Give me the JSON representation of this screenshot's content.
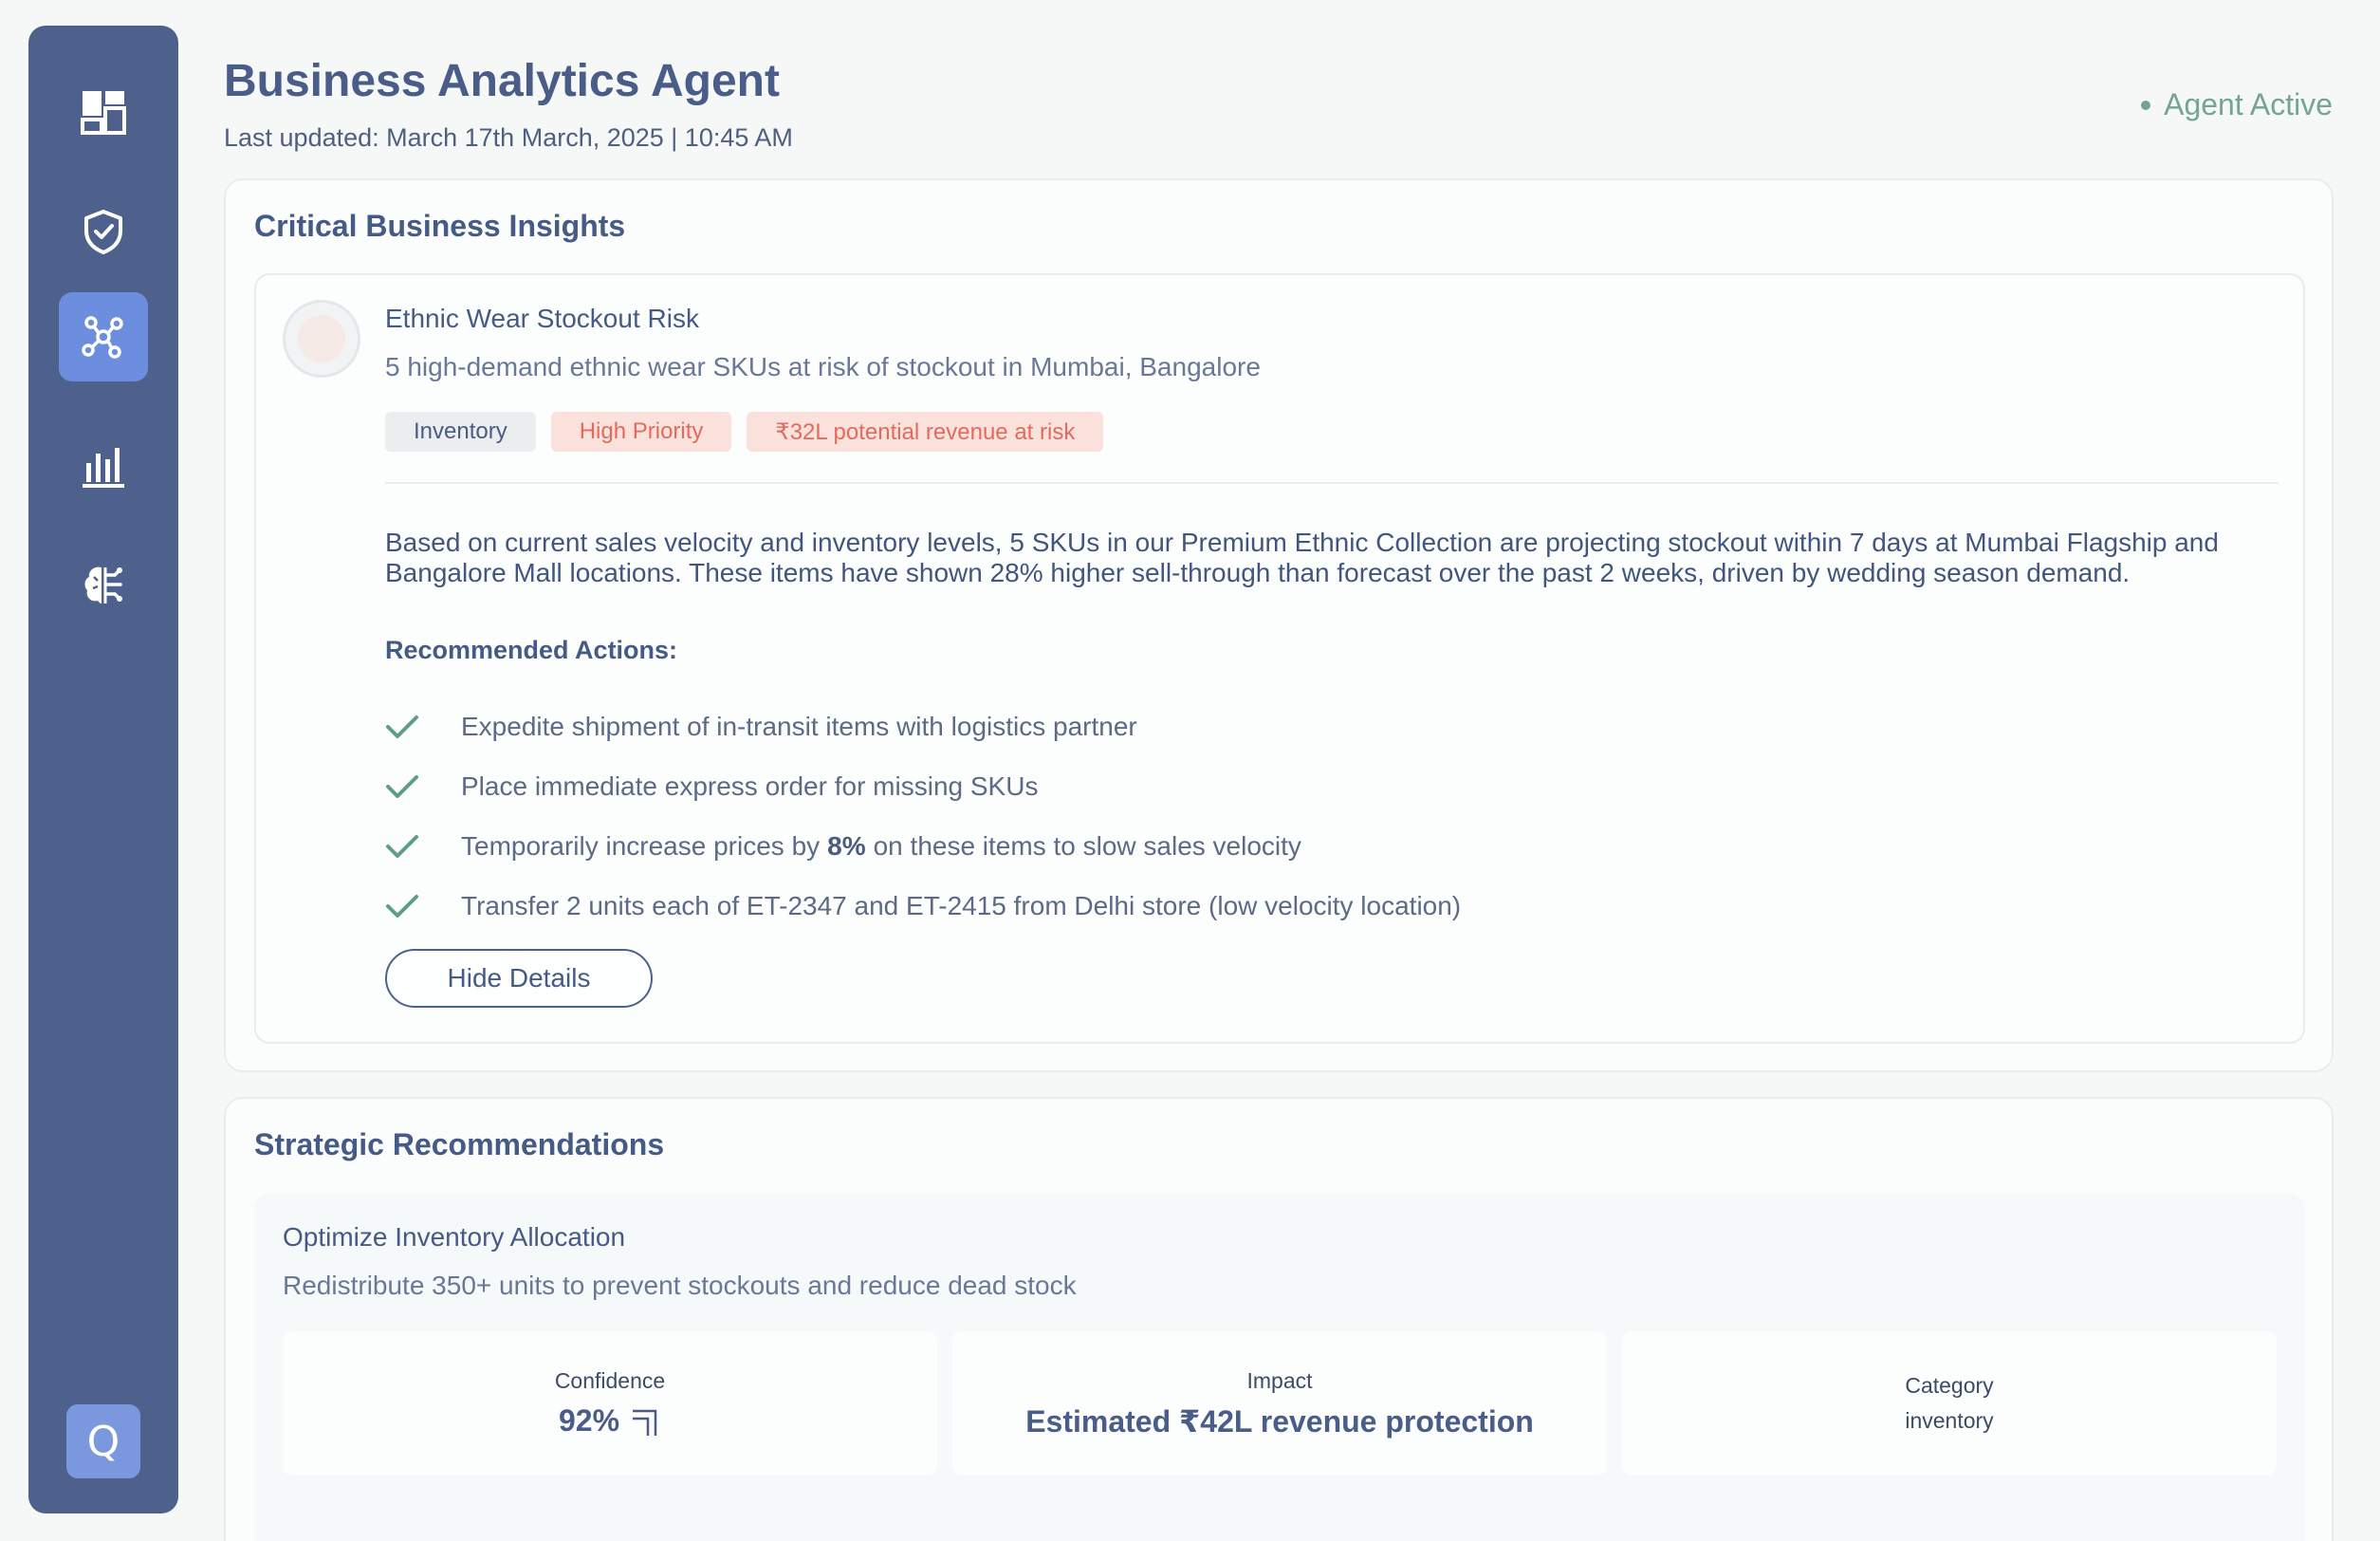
{
  "header": {
    "title": "Business Analytics Agent",
    "last_updated": "Last updated: March 17th March, 2025 | 10:45 AM",
    "status": "Agent Active"
  },
  "sidebar": {
    "items": [
      {
        "icon": "dashboard-icon",
        "active": false
      },
      {
        "icon": "shield-check-icon",
        "active": false
      },
      {
        "icon": "network-icon",
        "active": true
      },
      {
        "icon": "bar-chart-icon",
        "active": false
      },
      {
        "icon": "brain-icon",
        "active": false
      }
    ],
    "bottom_button": "Q"
  },
  "insights": {
    "title": "Critical Business Insights",
    "card": {
      "title": "Ethnic Wear Stockout Risk",
      "subtitle": "5 high-demand ethnic wear SKUs at risk of stockout in Mumbai, Bangalore",
      "tags": {
        "category": "Inventory",
        "priority": "High Priority",
        "risk": "₹32L potential revenue at risk"
      },
      "description": "Based on current sales velocity and inventory levels, 5 SKUs in our Premium Ethnic Collection are projecting stockout within 7 days at Mumbai Flagship and Bangalore Mall locations. These items have shown 28% higher sell-through than forecast over the past 2 weeks, driven by wedding season demand.",
      "recommended_heading": "Recommended Actions:",
      "actions": {
        "a1": "Expedite shipment of in-transit items with logistics partner",
        "a2": "Place immediate express order for missing SKUs",
        "a3_pre": "Temporarily increase prices by",
        "a3_bold": "8%",
        "a3_post": "on these items to slow sales velocity",
        "a4": "Transfer 2 units each of ET-2347 and ET-2415 from Delhi store (low velocity location)"
      },
      "hide_button": "Hide Details"
    }
  },
  "strategic": {
    "title": "Strategic Recommendations",
    "card": {
      "title": "Optimize Inventory Allocation",
      "subtitle": "Redistribute 350+ units to prevent stockouts and reduce dead stock",
      "confidence_label": "Confidence",
      "confidence_value": "92%",
      "impact_label": "Impact",
      "impact_value": "Estimated ₹42L revenue protection",
      "category_label": "Category",
      "category_value": "inventory"
    }
  },
  "colors": {
    "sidebar": "#4e608c",
    "sidebar_active": "#6d8ede",
    "accent_text": "#465a86",
    "status_green": "#74a496",
    "priority_red": "#e16c5d"
  }
}
